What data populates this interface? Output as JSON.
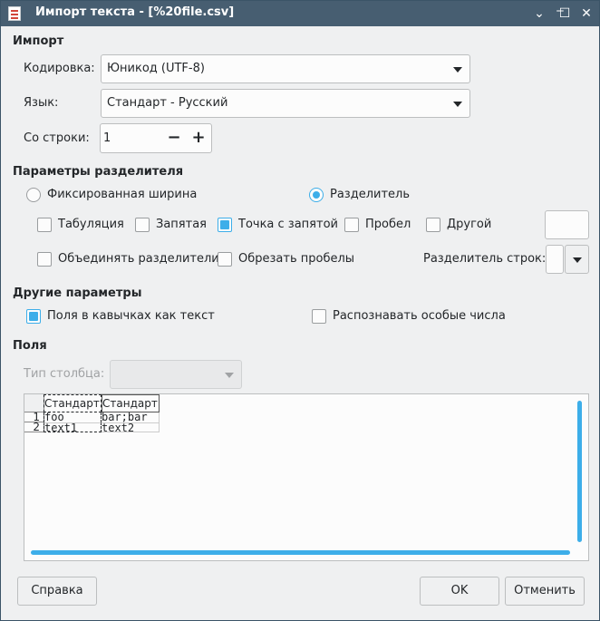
{
  "window": {
    "title": "Импорт текста - [%20file.csv]"
  },
  "import": {
    "section": "Импорт",
    "encoding_label": "Кодировка:",
    "encoding_value": "Юникод (UTF-8)",
    "language_label": "Язык:",
    "language_value": "Стандарт - Русский",
    "from_row_label": "Со строки:",
    "from_row_value": "1",
    "minus": "−",
    "plus": "+"
  },
  "separator": {
    "section": "Параметры разделителя",
    "fixed_width": "Фиксированная ширина",
    "separated": "Разделитель",
    "tab": "Табуляция",
    "comma": "Запятая",
    "semicolon": "Точка с запятой",
    "space": "Пробел",
    "other": "Другой",
    "merge": "Объединять разделители",
    "trim": "Обрезать пробелы",
    "string_delim": "Разделитель строк:"
  },
  "other": {
    "section": "Другие параметры",
    "quoted_as_text": "Поля в кавычках как текст",
    "detect_special": "Распознавать особые числа"
  },
  "fields": {
    "section": "Поля",
    "column_type_label": "Тип столбца:",
    "headers": [
      "Стандарт",
      "Стандарт"
    ],
    "rows": [
      {
        "num": "1",
        "cells": [
          "foo",
          "bar;bar"
        ]
      },
      {
        "num": "2",
        "cells": [
          "text1",
          "text2"
        ]
      }
    ]
  },
  "buttons": {
    "help": "Справка",
    "ok": "OK",
    "cancel": "Отменить"
  },
  "colors": {
    "accent": "#3daee9",
    "titlebar": "#475e71"
  }
}
